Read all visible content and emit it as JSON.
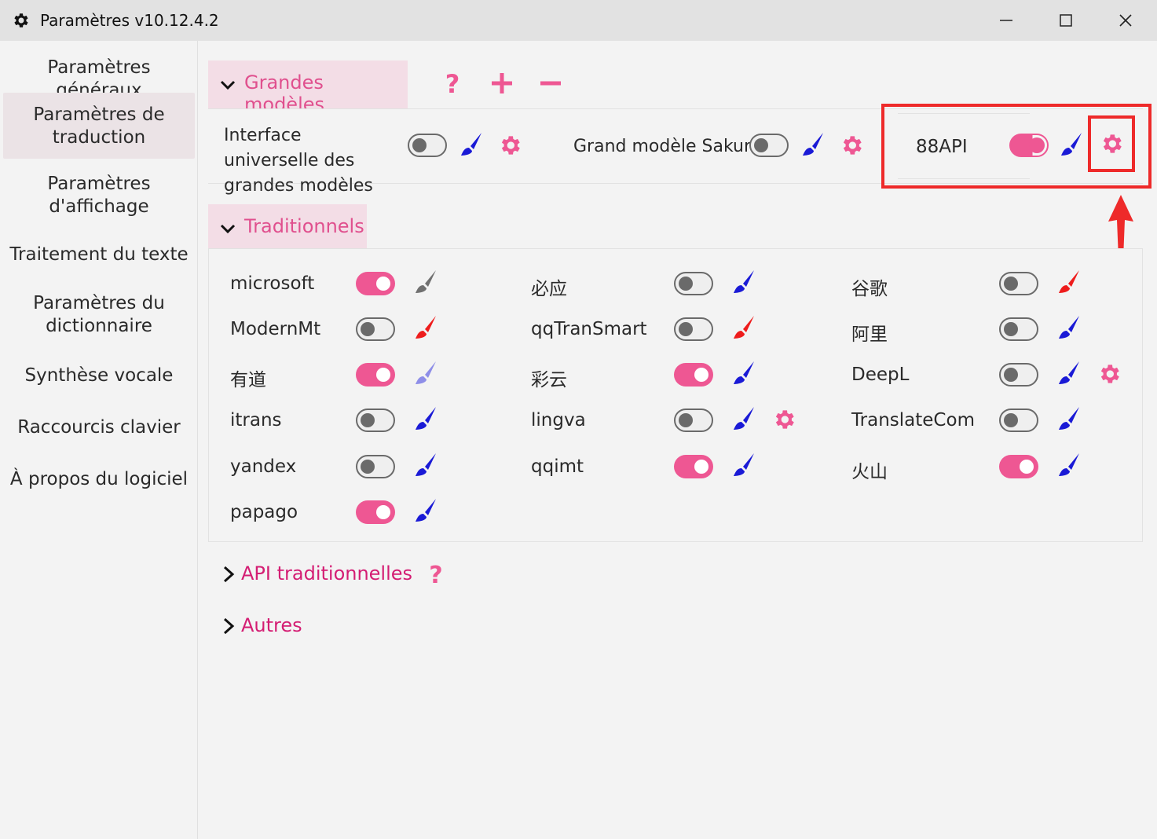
{
  "window": {
    "title": "Paramètres v10.12.4.2"
  },
  "sidebar": {
    "items": [
      {
        "label": "Paramètres généraux"
      },
      {
        "label": "Paramètres de traduction"
      },
      {
        "label": "Paramètres d'affichage"
      },
      {
        "label": "Traitement du texte"
      },
      {
        "label": "Paramètres du dictionnaire"
      },
      {
        "label": "Synthèse vocale"
      },
      {
        "label": "Raccourcis clavier"
      },
      {
        "label": "À propos du logiciel"
      }
    ],
    "active_index": 1
  },
  "large_models": {
    "title": "Grandes modèles",
    "help_glyph": "?",
    "items": [
      {
        "label": "Interface universelle des grandes modèles",
        "enabled": false,
        "brush_color": "#1a1ad6"
      },
      {
        "label": "Grand modèle Sakura",
        "enabled": false,
        "brush_color": "#1a1ad6"
      },
      {
        "label": "88API",
        "enabled": "partial",
        "brush_color": "#1a1ad6"
      }
    ]
  },
  "traditional": {
    "title": "Traditionnels",
    "items": [
      {
        "label": "microsoft",
        "enabled": true,
        "brush_color": "#707070"
      },
      {
        "label": "必应",
        "enabled": false,
        "brush_color": "#1a1ad6"
      },
      {
        "label": "谷歌",
        "enabled": false,
        "brush_color": "#ee1c1c"
      },
      {
        "label": "ModernMt",
        "enabled": false,
        "brush_color": "#ee1c1c"
      },
      {
        "label": "qqTranSmart",
        "enabled": false,
        "brush_color": "#ee1c1c"
      },
      {
        "label": "阿里",
        "enabled": false,
        "brush_color": "#1a1ad6"
      },
      {
        "label": "有道",
        "enabled": true,
        "brush_color": "#8e8ee8"
      },
      {
        "label": "彩云",
        "enabled": true,
        "brush_color": "#1a1ad6"
      },
      {
        "label": "DeepL",
        "enabled": false,
        "brush_color": "#1a1ad6"
      },
      {
        "label": "itrans",
        "enabled": false,
        "brush_color": "#1a1ad6"
      },
      {
        "label": "lingva",
        "enabled": false,
        "brush_color": "#1a1ad6"
      },
      {
        "label": "TranslateCom",
        "enabled": false,
        "brush_color": "#1a1ad6"
      },
      {
        "label": "yandex",
        "enabled": false,
        "brush_color": "#1a1ad6"
      },
      {
        "label": "qqimt",
        "enabled": true,
        "brush_color": "#1a1ad6"
      },
      {
        "label": "火山",
        "enabled": true,
        "brush_color": "#1a1ad6"
      },
      {
        "label": "papago",
        "enabled": true,
        "brush_color": "#1a1ad6"
      }
    ]
  },
  "traditional_api": {
    "title": "API traditionnelles",
    "help_glyph": "?"
  },
  "others": {
    "title": "Autres"
  },
  "colors": {
    "accent": "#ee5793",
    "accent_text": "#e0508e",
    "link_text": "#d41d73",
    "highlight": "#ee2a2a"
  }
}
